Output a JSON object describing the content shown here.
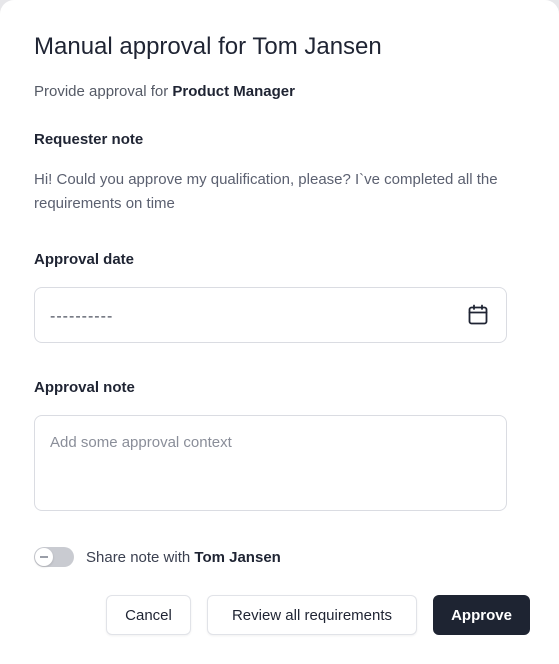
{
  "dialog": {
    "title": "Manual approval for Tom Jansen",
    "subtitle_prefix": "Provide approval for",
    "subtitle_role": "Product Manager"
  },
  "requester_note": {
    "label": "Requester note",
    "text": "Hi! Could you approve my qualification, please? I`ve completed all the requirements on time"
  },
  "approval_date": {
    "label": "Approval date",
    "value": "--‐--‐----",
    "icon": "calendar-icon"
  },
  "approval_note": {
    "label": "Approval note",
    "value": "",
    "placeholder": "Add some approval context"
  },
  "share_toggle": {
    "enabled": false,
    "label_prefix": "Share note with",
    "label_name": "Tom Jansen"
  },
  "footer": {
    "cancel_label": "Cancel",
    "review_label": "Review all requirements",
    "approve_label": "Approve"
  },
  "colors": {
    "primary": "#1e2432",
    "border": "#dadce2",
    "muted_text": "#5b6070"
  }
}
